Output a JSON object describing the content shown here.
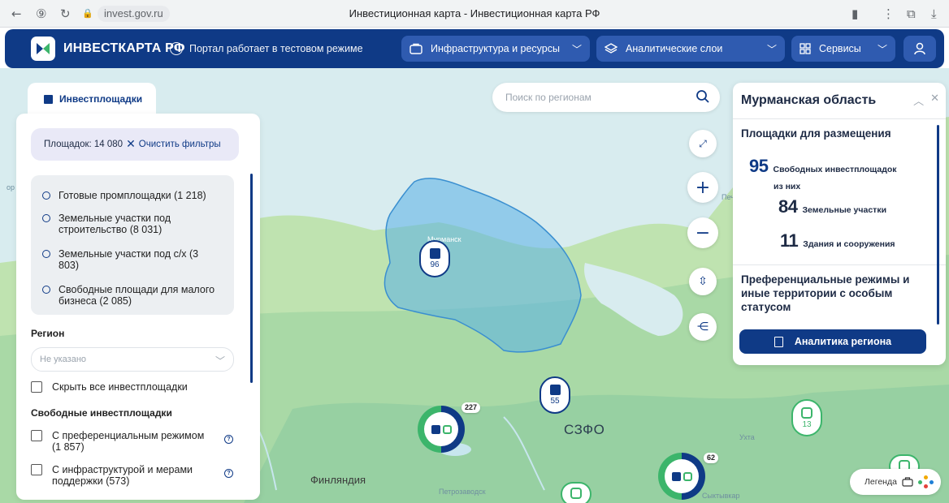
{
  "browser": {
    "url": "invest.gov.ru",
    "tab_title": "Инвестиционная карта - Инвестиционная карта РФ"
  },
  "header": {
    "logo_text": "ИНВЕСТКАРТА РФ",
    "notice": "Портал работает в тестовом режиме",
    "menu": [
      {
        "label": "Инфраструктура и ресурсы",
        "icon": "briefcase-icon"
      },
      {
        "label": "Аналитические слои",
        "icon": "layers-icon"
      },
      {
        "label": "Сервисы",
        "icon": "grid-icon"
      }
    ],
    "user_icon": "user-icon"
  },
  "left_panel": {
    "tab_label": "Инвестплощадки",
    "count_text": "Площадок: 14 080",
    "clear_label": "Очистить фильтры",
    "types": [
      "Готовые промплощадки (1 218)",
      "Земельные участки под строительство (8 031)",
      "Земельные участки под с/х (3 803)",
      "Свободные площади для малого бизнеса (2 085)"
    ],
    "region_title": "Регион",
    "region_placeholder": "Не указано",
    "hide_all_label": "Скрыть все инвестплощадки",
    "free_title": "Свободные инвестплощадки",
    "free_options": [
      "С преференциальным режимом (1 857)",
      "С инфраструктурой и мерами поддержки (573)"
    ]
  },
  "search": {
    "placeholder": "Поиск по регионам"
  },
  "map": {
    "labels": {
      "murmansk": "Мурманск",
      "szfo": "СЗФО",
      "finland": "Финляндия",
      "petrozavodsk": "Петрозаводск",
      "ukhta": "Ухта",
      "syktyvkar": "Сыктывкар",
      "pechora": "Печ",
      "or": "ор"
    },
    "pins": [
      {
        "count": "96",
        "kind": "building"
      },
      {
        "count": "55",
        "kind": "building"
      },
      {
        "count": "13",
        "kind": "target"
      }
    ],
    "clusters": [
      {
        "count": "227"
      },
      {
        "count": "62"
      }
    ],
    "colors": {
      "region": "#5ab0e6",
      "land": "#bfe3b0",
      "water": "#d8ecef",
      "accent": "#0f3a86",
      "green": "#3cb56b"
    }
  },
  "right_panel": {
    "title": "Мурманская область",
    "section1": "Площадки для размещения",
    "free_count": "95",
    "free_label": "Свободных инвестплощадок",
    "of_them": "из них",
    "land_count": "84",
    "land_label": "Земельные участки",
    "bld_count": "11",
    "bld_label": "Здания и сооружения",
    "section2": "Преференциальные режимы и иные территории с особым статусом",
    "analytics_label": "Аналитика региона"
  },
  "legend": {
    "label": "Легенда"
  }
}
